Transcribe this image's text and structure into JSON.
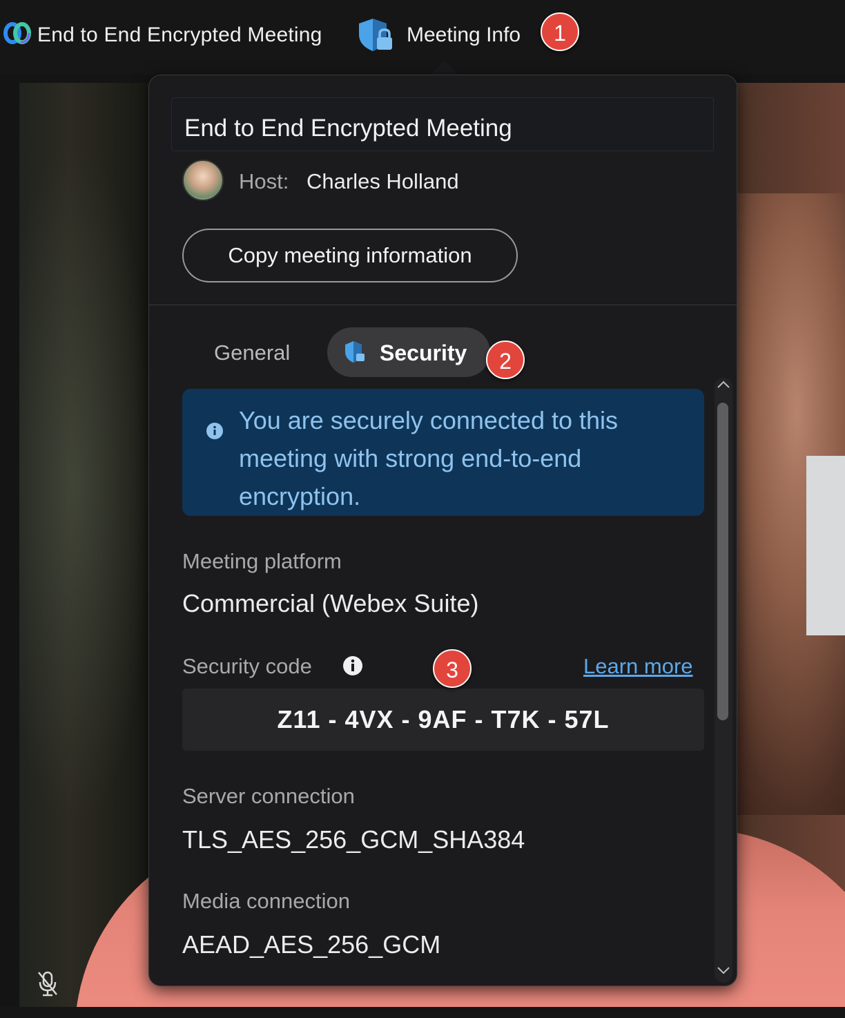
{
  "topbar": {
    "app_icon": "webex-logo-icon",
    "title": "End to End Encrypted Meeting",
    "meeting_info_icon": "shield-lock-icon",
    "meeting_info_label": "Meeting Info"
  },
  "callouts": {
    "one": "1",
    "two": "2",
    "three": "3"
  },
  "popover": {
    "meeting_title": "End to End Encrypted Meeting",
    "host_label": "Host:",
    "host_name": "Charles Holland",
    "copy_button": "Copy meeting information",
    "tabs": [
      {
        "label": "General",
        "selected": false
      },
      {
        "label": "Security",
        "selected": true,
        "icon": "shield-icon"
      }
    ],
    "banner": {
      "icon": "info-icon",
      "message": "You are securely connected to this meeting with strong end-to-end encryption."
    },
    "platform": {
      "label": "Meeting platform",
      "value": "Commercial (Webex Suite)"
    },
    "security_code": {
      "label": "Security code",
      "icon": "info-icon",
      "learn_more": "Learn more",
      "value": "Z11 - 4VX - 9AF - T7K - 57L"
    },
    "server": {
      "label": "Server connection",
      "value": "TLS_AES_256_GCM_SHA384"
    },
    "media": {
      "label": "Media connection",
      "value": "AEAD_AES_256_GCM"
    }
  },
  "video": {
    "status_icon": "microphone-muted-icon"
  },
  "colors": {
    "accent_badge": "#e2453b",
    "banner_bg": "#0e3558",
    "banner_text": "#8fc3ee",
    "link": "#5ca8ea",
    "popover_bg": "#1b1b1d"
  }
}
